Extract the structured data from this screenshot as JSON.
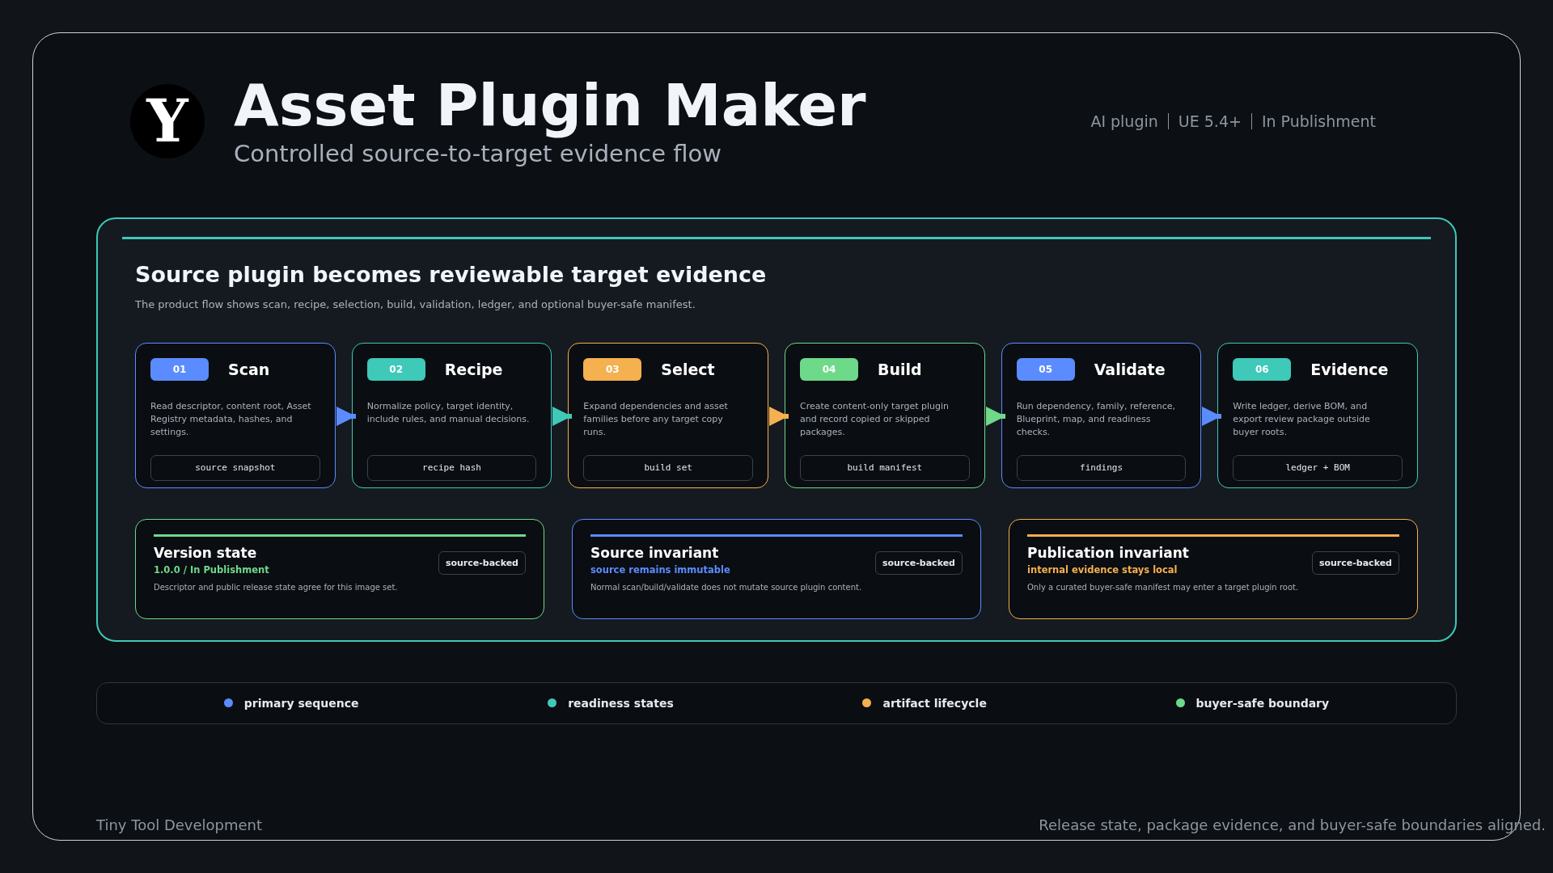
{
  "header": {
    "logo": "Y",
    "title": "Asset Plugin Maker",
    "subtitle": "Controlled source-to-target evidence flow",
    "meta": [
      "AI plugin",
      "UE 5.4+",
      "In Publishment"
    ]
  },
  "panel": {
    "title": "Source plugin becomes reviewable target evidence",
    "description": "The product flow shows scan, recipe, selection, build, validation, ledger, and optional buyer-safe manifest.",
    "steps": [
      {
        "number": "01",
        "title": "Scan",
        "text": "Read descriptor, content root, Asset Registry metadata, hashes, and settings.",
        "output": "source snapshot",
        "color": "#5b8cff"
      },
      {
        "number": "02",
        "title": "Recipe",
        "text": "Normalize policy, target identity, include rules, and manual decisions.",
        "output": "recipe hash",
        "color": "#3ec9b8"
      },
      {
        "number": "03",
        "title": "Select",
        "text": "Expand dependencies and asset families before any target copy runs.",
        "output": "build set",
        "color": "#f5b04f"
      },
      {
        "number": "04",
        "title": "Build",
        "text": "Create content-only target plugin and record copied or skipped packages.",
        "output": "build manifest",
        "color": "#6fd98a"
      },
      {
        "number": "05",
        "title": "Validate",
        "text": "Run dependency, family, reference, Blueprint, map, and readiness checks.",
        "output": "findings",
        "color": "#5b8cff"
      },
      {
        "number": "06",
        "title": "Evidence",
        "text": "Write ledger, derive BOM, and export review package outside buyer roots.",
        "output": "ledger + BOM",
        "color": "#3ec9b8"
      }
    ],
    "invariants": [
      {
        "title": "Version state",
        "status": "1.0.0 / In Publishment",
        "text": "Descriptor and public release state agree for this image set.",
        "tag": "source-backed",
        "color": "#6fd98a"
      },
      {
        "title": "Source invariant",
        "status": "source remains immutable",
        "text": "Normal scan/build/validate does not mutate source plugin content.",
        "tag": "source-backed",
        "color": "#5b8cff"
      },
      {
        "title": "Publication invariant",
        "status": "internal evidence stays local",
        "text": "Only a curated buyer-safe manifest may enter a target plugin root.",
        "tag": "source-backed",
        "color": "#f5b04f"
      }
    ]
  },
  "legend": [
    {
      "label": "primary sequence",
      "color": "#5b8cff"
    },
    {
      "label": "readiness states",
      "color": "#3ec9b8"
    },
    {
      "label": "artifact lifecycle",
      "color": "#f5b04f"
    },
    {
      "label": "buyer-safe boundary",
      "color": "#6fd98a"
    }
  ],
  "footer": {
    "left": "Tiny Tool Development",
    "right": "Release state, package evidence, and buyer-safe boundaries aligned."
  }
}
